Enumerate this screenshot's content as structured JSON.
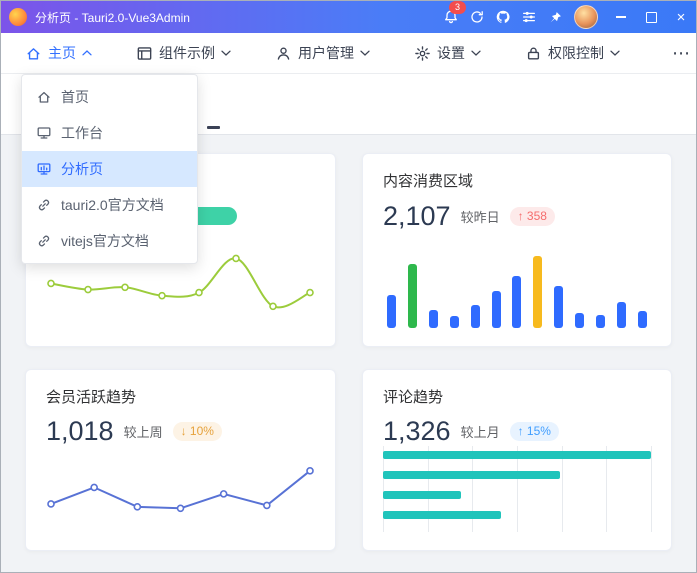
{
  "window": {
    "title": "分析页 - Tauri2.0-Vue3Admin"
  },
  "titlebar": {
    "notification_count": "3"
  },
  "navbar": {
    "items": [
      {
        "label": "主页",
        "icon": "home-icon",
        "active": true,
        "caret": "up"
      },
      {
        "label": "组件示例",
        "icon": "component-icon",
        "active": false,
        "caret": "down"
      },
      {
        "label": "用户管理",
        "icon": "user-icon",
        "active": false,
        "caret": "down"
      },
      {
        "label": "设置",
        "icon": "gear-icon",
        "active": false,
        "caret": "down"
      },
      {
        "label": "权限控制",
        "icon": "lock-icon",
        "active": false,
        "caret": "down"
      }
    ],
    "more_label": "⋯"
  },
  "dropdown": {
    "items": [
      {
        "label": "首页",
        "icon": "home-icon",
        "active": false
      },
      {
        "label": "工作台",
        "icon": "workbench-icon",
        "active": false
      },
      {
        "label": "分析页",
        "icon": "analysis-icon",
        "active": true
      },
      {
        "label": "tauri2.0官方文档",
        "icon": "link-icon",
        "active": false
      },
      {
        "label": "vitejs官方文档",
        "icon": "link-icon",
        "active": false
      }
    ]
  },
  "cards": {
    "hidden": {
      "badge_text": ""
    },
    "consumption": {
      "title": "内容消费区域",
      "value": "2,107",
      "compare_label": "较昨日",
      "badge_text": "↑ 358"
    },
    "member": {
      "title": "会员活跃趋势",
      "value": "1,018",
      "compare_label": "较上周",
      "badge_text": "↓ 10%"
    },
    "comment": {
      "title": "评论趋势",
      "value": "1,326",
      "compare_label": "较上月",
      "badge_text": "↑ 15%"
    }
  },
  "colors": {
    "primary": "#3370ff",
    "titlebar_gradient_start": "#7c54e9",
    "titlebar_gradient_end": "#3a79f7",
    "badge_red_text": "#f56c6c",
    "badge_orange_text": "#e6a23c",
    "badge_blue_text": "#409eff",
    "badge_teal": "#3ed2a7",
    "notification_badge": "#f34d4d"
  },
  "chart_data": [
    {
      "type": "line",
      "card": "top-left-hidden-card",
      "smooth": true,
      "color": "#9ccc3c",
      "values": [
        52,
        44,
        47,
        36,
        40,
        85,
        22,
        40
      ],
      "ylim": [
        0,
        100
      ],
      "grid": false,
      "markers": true
    },
    {
      "type": "bar",
      "card": "内容消费区域",
      "color_default": "#2f6bff",
      "color_overrides": {
        "1": "#2eb84c",
        "7": "#f7ba1e"
      },
      "values": [
        36,
        70,
        20,
        13,
        25,
        40,
        57,
        78,
        46,
        16,
        14,
        28,
        18
      ],
      "ylim": [
        0,
        100
      ],
      "grid": false
    },
    {
      "type": "line",
      "card": "会员活跃趋势",
      "smooth": false,
      "color": "#5872d5",
      "values": [
        32,
        55,
        28,
        26,
        46,
        30,
        78
      ],
      "ylim": [
        0,
        100
      ],
      "grid": false,
      "markers": true
    },
    {
      "type": "hbar",
      "card": "评论趋势",
      "color": "#20c4bb",
      "values": [
        100,
        66,
        29,
        44
      ],
      "xlim": [
        0,
        100
      ],
      "grid": true
    }
  ]
}
